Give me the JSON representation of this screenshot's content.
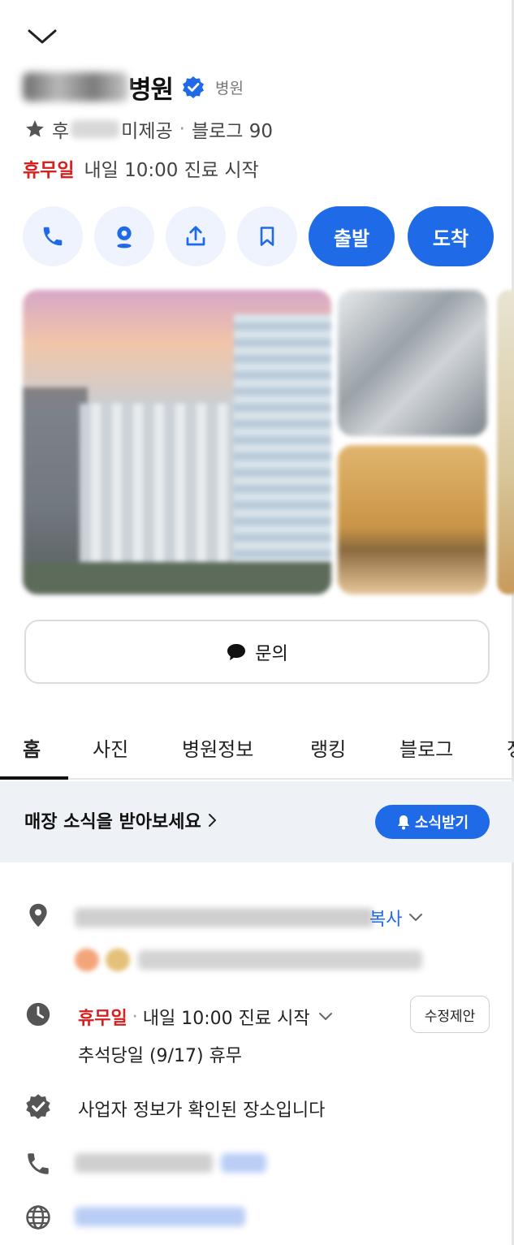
{
  "header": {
    "name_suffix": "병원",
    "category": "병원",
    "rating_prefix": "후",
    "rating_text": "미제공",
    "blog_text": "블로그 90"
  },
  "status": {
    "closed_label": "휴무일",
    "next_open": "내일 10:00 진료 시작"
  },
  "actions": {
    "depart_label": "출발",
    "arrive_label": "도착"
  },
  "inquiry_label": "문의",
  "tabs": [
    "홈",
    "사진",
    "병원정보",
    "랭킹",
    "블로그",
    "정"
  ],
  "news": {
    "text": "매장 소식을 받아보세요",
    "button_label": "소식받기"
  },
  "info": {
    "address_suffix": "복사",
    "hours_closed": "휴무일",
    "hours_next": "내일 10:00 진료 시작",
    "edit_label": "수정제안",
    "holiday_note": "추석당일 (9/17) 휴무",
    "verified_text": "사업자 정보가 확인된 장소입니다"
  },
  "colors": {
    "accent": "#1f6ae6",
    "closed_red": "#d71f1f",
    "light_blue_bg": "#eef3fd"
  }
}
